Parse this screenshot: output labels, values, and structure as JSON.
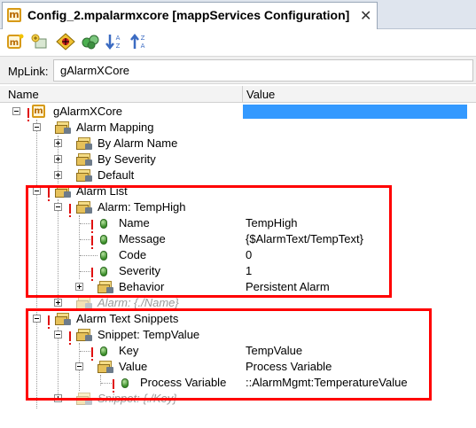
{
  "tab": {
    "icon": "mapp-core-icon",
    "title": "Config_2.mpalarmxcore [mappServices Configuration]",
    "close": "✕"
  },
  "toolbar": {
    "buttons": [
      {
        "name": "mapp-settings-icon"
      },
      {
        "name": "add-element-icon"
      },
      {
        "name": "cross-reference-icon"
      },
      {
        "name": "properties-icon"
      },
      {
        "name": "sort-ascending-icon"
      },
      {
        "name": "sort-descending-icon"
      }
    ]
  },
  "mplink": {
    "label": "MpLink:",
    "value": "gAlarmXCore"
  },
  "columns": {
    "name": "Name",
    "value": "Value"
  },
  "tree": {
    "root": "gAlarmXCore",
    "alarm_mapping": "Alarm Mapping",
    "by_alarm_name": "By Alarm Name",
    "by_severity": "By Severity",
    "default": "Default",
    "alarm_list": "Alarm List",
    "alarm_temphigh": "Alarm: TempHigh",
    "name_label": "Name",
    "name_value": "TempHigh",
    "message_label": "Message",
    "message_value": "{$AlarmText/TempText}",
    "code_label": "Code",
    "code_value": "0",
    "severity_label": "Severity",
    "severity_value": "1",
    "behavior_label": "Behavior",
    "behavior_value": "Persistent Alarm",
    "alarm_placeholder": "Alarm: {./Name}",
    "alarm_text_snippets": "Alarm Text Snippets",
    "snippet_tempvalue": "Snippet: TempValue",
    "key_label": "Key",
    "key_value": "TempValue",
    "value_label": "Value",
    "value_value": "Process Variable",
    "process_variable_label": "Process Variable",
    "process_variable_value": "::AlarmMgmt:TemperatureValue",
    "snippet_placeholder": "Snippet: {./Key}"
  },
  "colors": {
    "highlight": "#ff0000",
    "selection": "#3399ff",
    "required_marker": "#e01010"
  }
}
